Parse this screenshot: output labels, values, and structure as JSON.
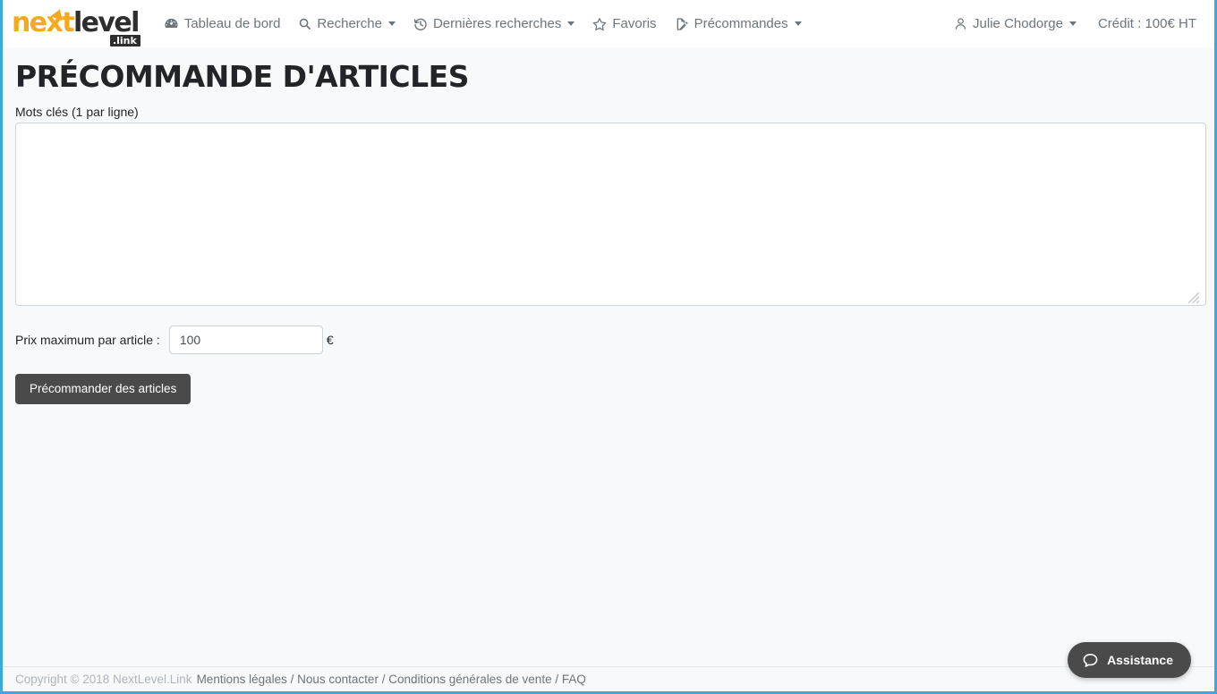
{
  "brand": {
    "part1": "next",
    "part2": "level",
    "badge": ".link",
    "color_primary": "#f5a91d",
    "color_secondary": "#2e2e2e"
  },
  "navbar": {
    "items": [
      {
        "label": "Tableau de bord",
        "icon": "tachometer-icon",
        "caret": false
      },
      {
        "label": "Recherche",
        "icon": "search-icon",
        "caret": true
      },
      {
        "label": "Dernières recherches",
        "icon": "history-icon",
        "caret": true
      },
      {
        "label": "Favoris",
        "icon": "star-icon",
        "caret": false
      },
      {
        "label": "Précommandes",
        "icon": "file-signature-icon",
        "caret": true
      }
    ],
    "user": {
      "label": "Julie Chodorge",
      "icon": "user-icon",
      "caret": true
    },
    "credit": "Crédit : 100€ HT"
  },
  "main": {
    "title": "PRÉCOMMANDE D'ARTICLES",
    "keywords": {
      "label": "Mots clés (1 par ligne)",
      "value": "",
      "placeholder": ""
    },
    "price": {
      "label": "Prix maximum par article :",
      "value": "100",
      "placeholder": "",
      "currency": "€"
    },
    "submit_label": "Précommander des articles"
  },
  "footer": {
    "copyright": "Copyright © 2018 NextLevel.Link",
    "links": [
      {
        "label": "Mentions légales"
      },
      {
        "label": "Nous contacter"
      },
      {
        "label": "Conditions générales de vente"
      },
      {
        "label": "FAQ"
      }
    ],
    "separator": " / "
  },
  "assistance": {
    "label": "Assistance",
    "icon": "chat-bubble-icon"
  },
  "theme": {
    "accent_blue": "#3aa9dd",
    "body_bg": "#f8f9fa",
    "button_dark": "#4a4a4a",
    "muted_text": "#6c757d"
  }
}
